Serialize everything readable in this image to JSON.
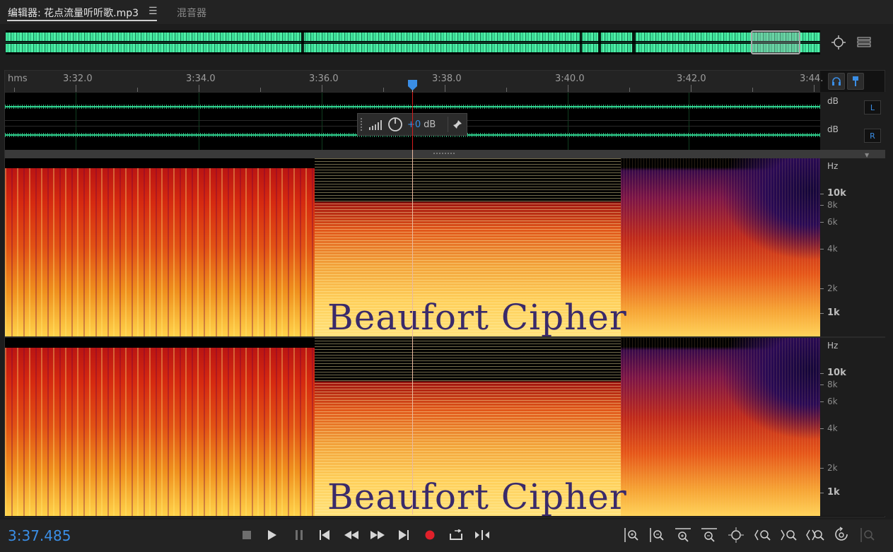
{
  "tabs": [
    {
      "label": "编辑器: 花点流量听听歌.mp3",
      "active": true
    },
    {
      "label": "混音器",
      "active": false
    }
  ],
  "tab_menu_icon": "☰",
  "overview": {
    "zoom_icon": "zoom-fit-icon",
    "view_icon": "list-view-icon"
  },
  "ruler": {
    "unit_label": "hms",
    "ticks": [
      "3:32.0",
      "3:34.0",
      "3:36.0",
      "3:38.0",
      "3:40.0",
      "3:42.0",
      "3:44."
    ]
  },
  "waveform": {
    "db_label_top": "dB",
    "db_label_bottom": "dB",
    "channel_left": "L",
    "channel_right": "R"
  },
  "hud": {
    "value": "+0",
    "unit": "dB"
  },
  "spectrogram": {
    "watermark_text": "Beaufort Cipher",
    "hz_label": "Hz",
    "freq_labels": [
      "10k",
      "8k",
      "6k",
      "4k",
      "2k",
      "1k"
    ]
  },
  "transport": {
    "timecode": "3:37.485",
    "buttons": [
      "stop",
      "play",
      "pause",
      "go-to-start",
      "rewind",
      "fast-forward",
      "go-to-end",
      "record",
      "loop-playback",
      "skip-selection"
    ],
    "zoom_buttons": [
      "zoom-in-amplitude",
      "zoom-out-amplitude",
      "zoom-in-time",
      "zoom-out-time",
      "zoom-out-full",
      "zoom-in-selection-left",
      "zoom-in-selection-right",
      "zoom-to-selection",
      "zoom-reset",
      "zoom-disabled"
    ]
  },
  "colors": {
    "accent": "#3a8ee6",
    "waveform": "#3fe29b",
    "record": "#e0202a"
  }
}
